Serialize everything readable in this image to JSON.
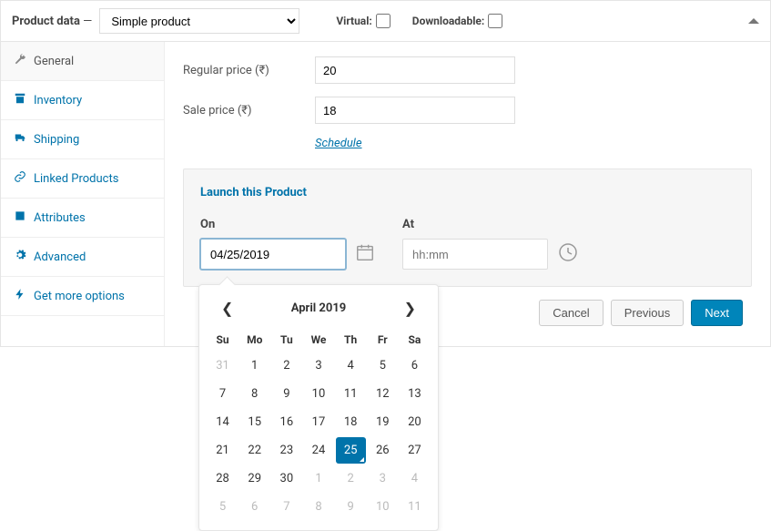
{
  "header": {
    "title_prefix": "Product data",
    "dash": "—",
    "product_type": "Simple product",
    "virtual_label": "Virtual:",
    "downloadable_label": "Downloadable:"
  },
  "tabs": [
    {
      "key": "general",
      "label": "General",
      "icon": "wrench"
    },
    {
      "key": "inventory",
      "label": "Inventory",
      "icon": "archive"
    },
    {
      "key": "shipping",
      "label": "Shipping",
      "icon": "truck"
    },
    {
      "key": "linked",
      "label": "Linked Products",
      "icon": "link"
    },
    {
      "key": "attributes",
      "label": "Attributes",
      "icon": "note"
    },
    {
      "key": "advanced",
      "label": "Advanced",
      "icon": "gear"
    },
    {
      "key": "more",
      "label": "Get more options",
      "icon": "bolt"
    }
  ],
  "active_tab": "general",
  "fields": {
    "regular_label": "Regular price (₹)",
    "regular_value": "20",
    "sale_label": "Sale price (₹)",
    "sale_value": "18",
    "schedule_label": "Schedule"
  },
  "launch": {
    "title": "Launch this Product",
    "on_label": "On",
    "on_value": "04/25/2019",
    "at_label": "At",
    "at_placeholder": "hh:mm"
  },
  "buttons": {
    "cancel": "Cancel",
    "previous": "Previous",
    "next": "Next"
  },
  "calendar": {
    "title": "April 2019",
    "dow": [
      "Su",
      "Mo",
      "Tu",
      "We",
      "Th",
      "Fr",
      "Sa"
    ],
    "cells": [
      {
        "n": 31,
        "muted": true
      },
      {
        "n": 1
      },
      {
        "n": 2
      },
      {
        "n": 3
      },
      {
        "n": 4
      },
      {
        "n": 5
      },
      {
        "n": 6
      },
      {
        "n": 7
      },
      {
        "n": 8
      },
      {
        "n": 9
      },
      {
        "n": 10
      },
      {
        "n": 11
      },
      {
        "n": 12
      },
      {
        "n": 13
      },
      {
        "n": 14
      },
      {
        "n": 15
      },
      {
        "n": 16
      },
      {
        "n": 17
      },
      {
        "n": 18
      },
      {
        "n": 19
      },
      {
        "n": 20
      },
      {
        "n": 21
      },
      {
        "n": 22
      },
      {
        "n": 23
      },
      {
        "n": 24
      },
      {
        "n": 25,
        "selected": true
      },
      {
        "n": 26
      },
      {
        "n": 27
      },
      {
        "n": 28
      },
      {
        "n": 29
      },
      {
        "n": 30
      },
      {
        "n": 1,
        "muted": true
      },
      {
        "n": 2,
        "muted": true
      },
      {
        "n": 3,
        "muted": true
      },
      {
        "n": 4,
        "muted": true
      },
      {
        "n": 5,
        "muted": true
      },
      {
        "n": 6,
        "muted": true
      },
      {
        "n": 7,
        "muted": true
      },
      {
        "n": 8,
        "muted": true
      },
      {
        "n": 9,
        "muted": true
      },
      {
        "n": 10,
        "muted": true
      },
      {
        "n": 11,
        "muted": true
      }
    ]
  }
}
